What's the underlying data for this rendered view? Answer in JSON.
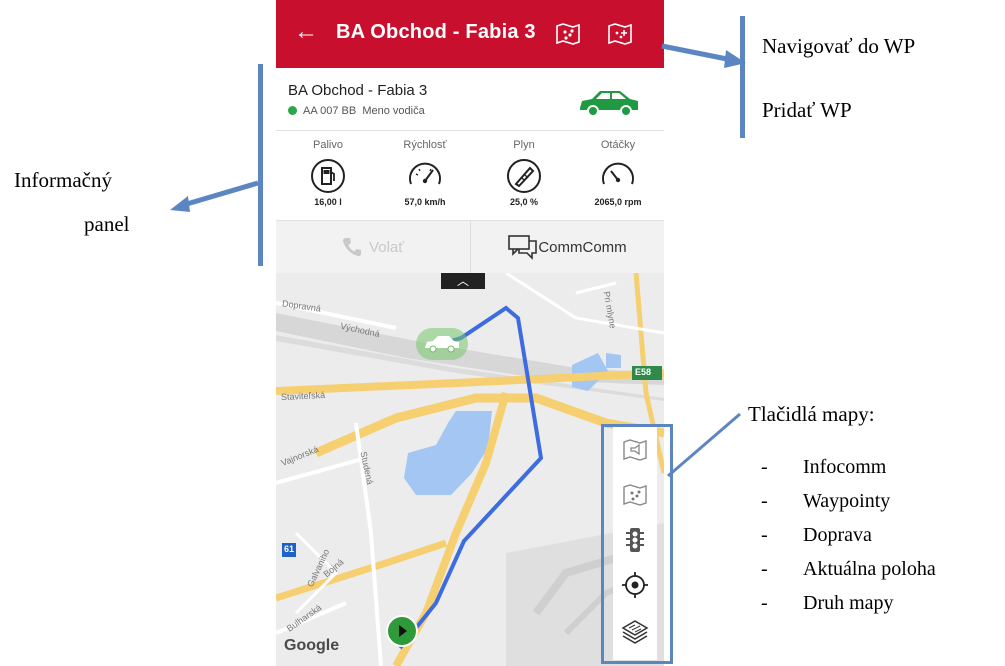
{
  "appbar": {
    "title": "BA Obchod - Fabia 3",
    "back_icon": "arrow-left-icon",
    "icons": [
      "waypoints-map-icon",
      "add-waypoint-map-icon"
    ],
    "color": "#c8102e"
  },
  "vehicle": {
    "name": "BA Obchod - Fabia 3",
    "plate": "AA 007 BB",
    "driver": "Meno vodiča",
    "status_color": "#2aa748"
  },
  "gauges": [
    {
      "label": "Palivo",
      "value": "16,00 l",
      "icon": "fuel-icon"
    },
    {
      "label": "Rýchlosť",
      "value": "57,0 km/h",
      "icon": "speedometer-icon"
    },
    {
      "label": "Plyn",
      "value": "25,0 %",
      "icon": "throttle-icon"
    },
    {
      "label": "Otáčky",
      "value": "2065,0 rpm",
      "icon": "rpm-icon"
    }
  ],
  "actions": {
    "call": "Volať",
    "comm": "CommComm"
  },
  "map": {
    "labels": {
      "dopravna": "Dopravná",
      "vychodna": "Východná",
      "stavitelska": "Staviteľská",
      "vajnorska": "Vajnorská",
      "studena": "Studená",
      "galvaniho": "Galvaniho",
      "bulharska": "Bulharská",
      "bojna": "Bojná",
      "pri_mlyne": "Pri mlyne",
      "e58": "E58",
      "route61": "61",
      "google": "Google"
    },
    "route_color": "#3d6be0",
    "buttons": [
      "infocomm-icon",
      "waypoints-icon",
      "traffic-light-icon",
      "location-target-icon",
      "map-layers-icon"
    ]
  },
  "annotations": {
    "info_panel_line1": "Informačný",
    "info_panel_line2": "panel",
    "navigate": "Navigovať do WP",
    "add_wp": "Pridať WP",
    "map_buttons_title": "Tlačidlá mapy:",
    "map_buttons": [
      "Infocomm",
      "Waypointy",
      "Doprava",
      "Aktuálna poloha",
      "Druh mapy"
    ],
    "dash": "-",
    "accent": "#5b86c2"
  }
}
